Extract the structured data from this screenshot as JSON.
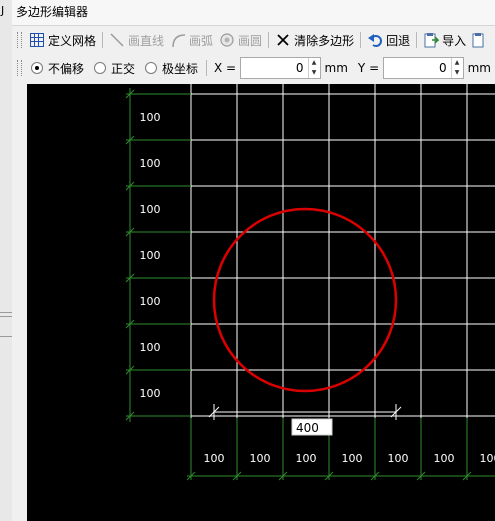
{
  "window": {
    "title": "多边形编辑器",
    "left_strip_char": "J"
  },
  "toolbar": {
    "define_grid": "定义网格",
    "draw_line": "画直线",
    "draw_arc": "画弧",
    "draw_circle": "画圆",
    "clear_polygon": "清除多边形",
    "undo": "回退",
    "import": "导入"
  },
  "options": {
    "no_offset": "不偏移",
    "orthogonal": "正交",
    "polar": "极坐标",
    "selected": "不偏移",
    "x_label": "X =",
    "x_value": "0",
    "x_unit": "mm",
    "y_label": "Y =",
    "y_value": "0",
    "y_unit": "mm"
  },
  "canvas": {
    "row_labels": [
      "100",
      "100",
      "100",
      "100",
      "100",
      "100",
      "100"
    ],
    "col_labels": [
      "100",
      "100",
      "100",
      "100",
      "100",
      "100",
      "100"
    ],
    "dimension_input": "400",
    "colors": {
      "background": "#000000",
      "grid": "#ffffff",
      "axis": "#2e8b2e",
      "circle": "#dd0000"
    }
  }
}
